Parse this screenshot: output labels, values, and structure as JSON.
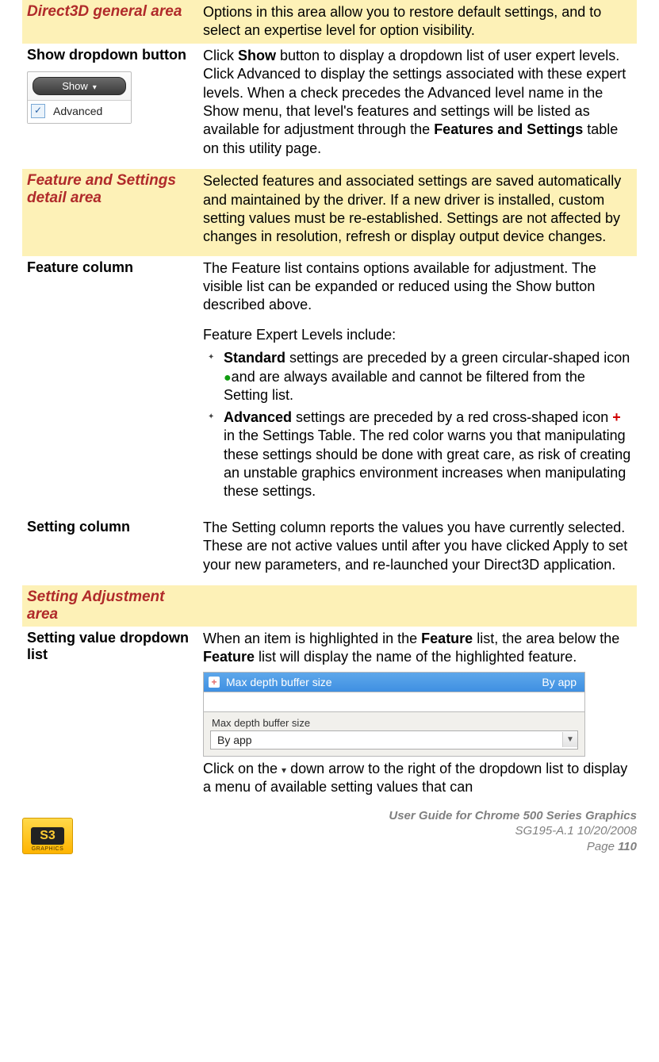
{
  "rows": {
    "r1": {
      "title": "Direct3D general area",
      "desc": "Options in this area allow you to restore default settings, and to select an expertise level for option visibility."
    },
    "r2": {
      "title": "Show dropdown button",
      "show_btn": "Show",
      "menu_item": "Advanced",
      "desc_pre": "Click ",
      "desc_bold1": "Show",
      "desc_mid": " button to display a dropdown list of user expert levels. Click Advanced to display the settings associated with these expert levels. When a check precedes the Advanced level name in the Show menu, that level's features and settings will be listed as available for adjustment through the ",
      "desc_bold2": "Features and Settings",
      "desc_post": " table on this utility page."
    },
    "r3": {
      "title": "Feature and Settings detail area",
      "desc": "Selected features and associated settings are saved automatically and maintained by the driver. If a new driver is installed, custom setting values must be re-established. Settings are not affected by changes in resolution, refresh or display output device changes."
    },
    "r4": {
      "title": "Feature column",
      "p1": "The Feature list contains options available for adjustment. The visible list can be expanded or reduced using the Show button described above.",
      "p2": "Feature Expert Levels include:",
      "b1_bold": "Standard",
      "b1_text": " settings are preceded by a green circular-shaped icon ",
      "b1_tail": "and are always available and cannot be filtered from the Setting list.",
      "b2_bold": "Advanced",
      "b2_text": " settings are preceded by a red cross-shaped icon ",
      "b2_tail": " in the Settings Table. The red color warns you that manipulating these settings should be done with great care, as risk of creating an unstable graphics environment increases when manipulating these settings."
    },
    "r5": {
      "title": "Setting column",
      "desc": "The Setting column reports the values you have currently selected. These are not active values until after you have clicked Apply to set your new parameters, and re-launched your Direct3D application."
    },
    "r6": {
      "title": "Setting Adjustment area"
    },
    "r7": {
      "title": "Setting value dropdown list",
      "p1_a": "When an item is highlighted in the ",
      "p1_b1": "Feature",
      "p1_b": " list, the area below the ",
      "p1_b2": "Feature",
      "p1_c": " list will display the name of the highlighted feature.",
      "sel_label": "Max depth buffer size",
      "sel_value": "By app",
      "dd_label": "Max depth buffer size",
      "dd_value": "By app",
      "p2_a": "Click on the ",
      "p2_b": " down arrow to the right of the dropdown list to display a menu of available setting values that can"
    }
  },
  "footer": {
    "logo": "S3",
    "logo_sub": "GRAPHICS",
    "line1": "User Guide for Chrome 500 Series Graphics",
    "line2": "SG195-A.1   10/20/2008",
    "page_label": "Page ",
    "page_num": "110"
  }
}
